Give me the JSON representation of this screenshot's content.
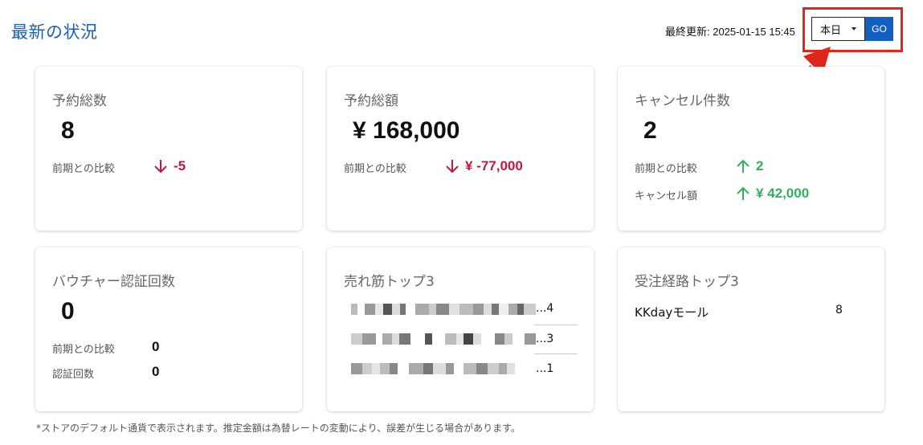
{
  "header": {
    "title": "最新の状況",
    "last_updated": "最終更新: 2025-01-15 15:45",
    "period_select": "本日",
    "go_label": "GO"
  },
  "cards": {
    "reservations": {
      "title": "予約総数",
      "value": "8",
      "compare_label": "前期との比較",
      "compare_value": "-5"
    },
    "amount": {
      "title": "予約総額",
      "value": "¥ 168,000",
      "compare_label": "前期との比較",
      "compare_value": "¥ -77,000"
    },
    "cancellations": {
      "title": "キャンセル件数",
      "value": "2",
      "compare_label": "前期との比較",
      "compare_value": "2",
      "cancel_amount_label": "キャンセル額",
      "cancel_amount_value": "¥ 42,000"
    },
    "vouchers": {
      "title": "バウチャー認証回数",
      "value": "0",
      "compare_label": "前期との比較",
      "compare_value": "0",
      "auth_label": "認証回数",
      "auth_value": "0"
    },
    "best_sellers": {
      "title": "売れ筋トップ3",
      "items": [
        {
          "count": "...4"
        },
        {
          "count": "...3"
        },
        {
          "count": "...1"
        }
      ]
    },
    "channels": {
      "title": "受注経路トップ3",
      "items": [
        {
          "name": "KKdayモール",
          "count": "8"
        }
      ]
    }
  },
  "footnote": "*ストアのデフォルト通貨で表示されます。推定金額は為替レートの変動により、誤差が生じる場合があります。",
  "colors": {
    "accent": "#1260c4",
    "down": "#c8163b",
    "up": "#2fb25a",
    "highlight": "#e0251b"
  }
}
